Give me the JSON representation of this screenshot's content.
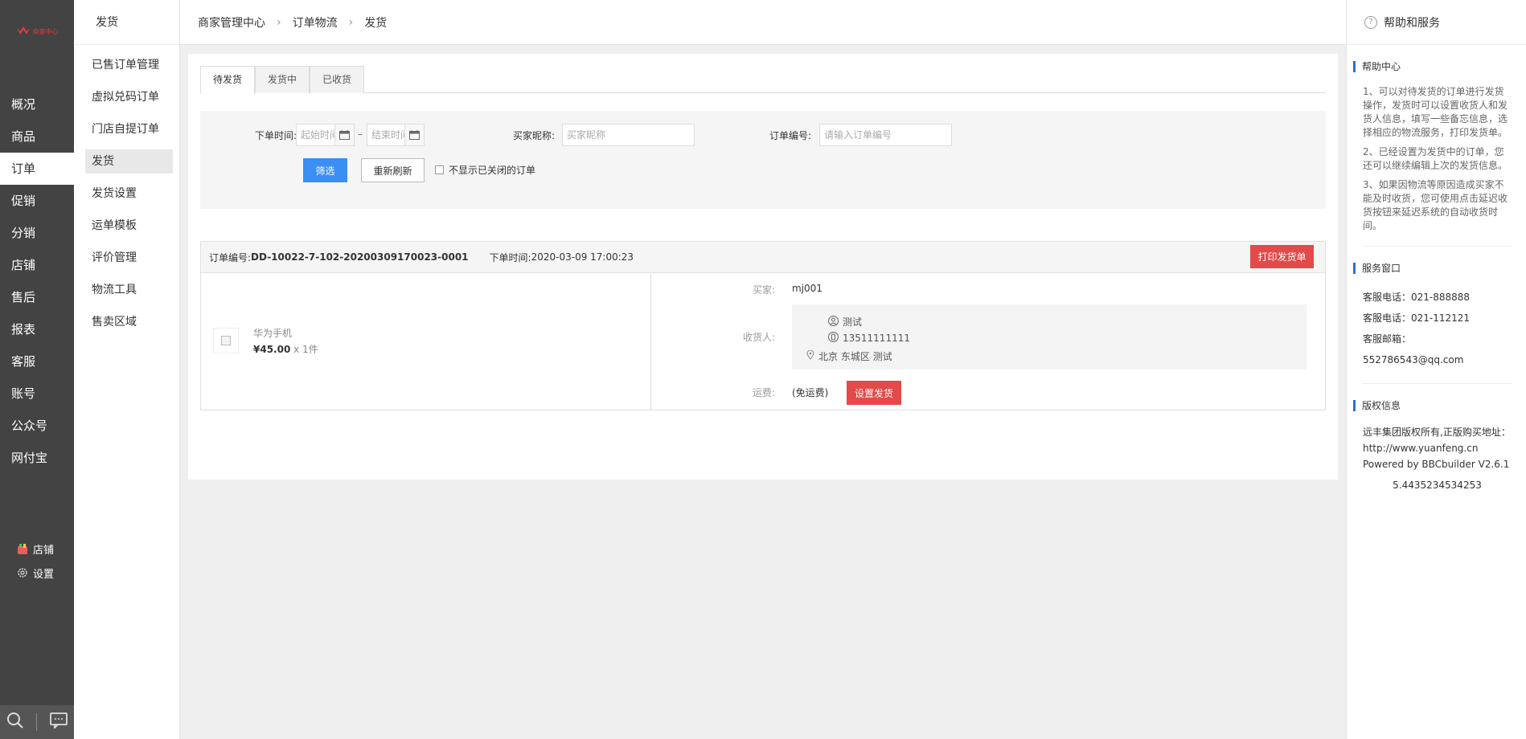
{
  "logo": {
    "text": "商家中心"
  },
  "nav": {
    "items": [
      {
        "label": "概况",
        "active": false
      },
      {
        "label": "商品",
        "active": false
      },
      {
        "label": "订单",
        "active": true
      },
      {
        "label": "促销",
        "active": false
      },
      {
        "label": "分销",
        "active": false
      },
      {
        "label": "店铺",
        "active": false
      },
      {
        "label": "售后",
        "active": false
      },
      {
        "label": "报表",
        "active": false
      },
      {
        "label": "客服",
        "active": false
      },
      {
        "label": "账号",
        "active": false
      },
      {
        "label": "公众号",
        "active": false
      },
      {
        "label": "网付宝",
        "active": false
      }
    ],
    "bottom": [
      {
        "label": "店铺",
        "icon": "shop-icon"
      },
      {
        "label": "设置",
        "icon": "gear-icon"
      }
    ],
    "footer_icons": [
      "search-icon",
      "message-icon"
    ]
  },
  "subnav": {
    "title": "发货",
    "items": [
      {
        "label": "已售订单管理",
        "active": false
      },
      {
        "label": "虚拟兑码订单",
        "active": false
      },
      {
        "label": "门店自提订单",
        "active": false
      },
      {
        "label": "发货",
        "active": true
      },
      {
        "label": "发货设置",
        "active": false
      },
      {
        "label": "运单模板",
        "active": false
      },
      {
        "label": "评价管理",
        "active": false
      },
      {
        "label": "物流工具",
        "active": false
      },
      {
        "label": "售卖区域",
        "active": false
      }
    ]
  },
  "breadcrumb": {
    "items": [
      "商家管理中心",
      "订单物流",
      "发货"
    ],
    "separator": "›"
  },
  "tabs": [
    {
      "label": "待发货",
      "active": true
    },
    {
      "label": "发货中",
      "active": false
    },
    {
      "label": "已收货",
      "active": false
    }
  ],
  "filter": {
    "order_time_label": "下单时间:",
    "start_placeholder": "起始时间",
    "end_placeholder": "结束时间",
    "dash": "–",
    "buyer_label": "买家昵称:",
    "buyer_placeholder": "买家昵称",
    "order_no_label": "订单编号:",
    "order_no_placeholder": "请输入订单编号",
    "filter_button": "筛选",
    "refresh_button": "重新刷新",
    "hide_closed_label": "不显示已关闭的订单"
  },
  "order": {
    "order_no_label": "订单编号:",
    "order_no": "DD-10022-7-102-20200309170023-0001",
    "order_time_label": "下单时间:",
    "order_time": "2020-03-09 17:00:23",
    "print_button": "打印发货单",
    "product_name": "华为手机",
    "price": "¥45.00",
    "quantity": "x 1件",
    "buyer_label": "买家:",
    "buyer": "mj001",
    "receiver_label": "收货人:",
    "receiver_name": "测试",
    "receiver_phone": "13511111111",
    "receiver_address": "北京 东城区 测试",
    "freight_label": "运费:",
    "freight": "(免运费)",
    "ship_button": "设置发货"
  },
  "help": {
    "title": "帮助和服务",
    "help_center_title": "帮助中心",
    "tips": [
      "1、可以对待发货的订单进行发货操作，发货时可以设置收货人和发货人信息，填写一些备忘信息，选择相应的物流服务，打印发货单。",
      "2、已经设置为发货中的订单，您还可以继续编辑上次的发货信息。",
      "3、如果因物流等原因造成买家不能及时收货，您可使用点击延迟收货按钮来延迟系统的自动收货时间。"
    ],
    "service_title": "服务窗口",
    "service_lines": [
      "客服电话：021-888888",
      "客服电话：021-112121",
      "客服邮箱：552786543@qq.com"
    ],
    "copyright_title": "版权信息",
    "copyright_line1": "远丰集团版权所有,正版购买地址：http://www.yuanfeng.cn",
    "copyright_line2": "Powered by BBCbuilder V2.6.1",
    "version": "5.4435234534253"
  },
  "colors": {
    "accent_blue": "#3b8ef3",
    "accent_red": "#e34a4a",
    "nav_bg": "#434343",
    "help_bar": "#2d6fd2"
  }
}
